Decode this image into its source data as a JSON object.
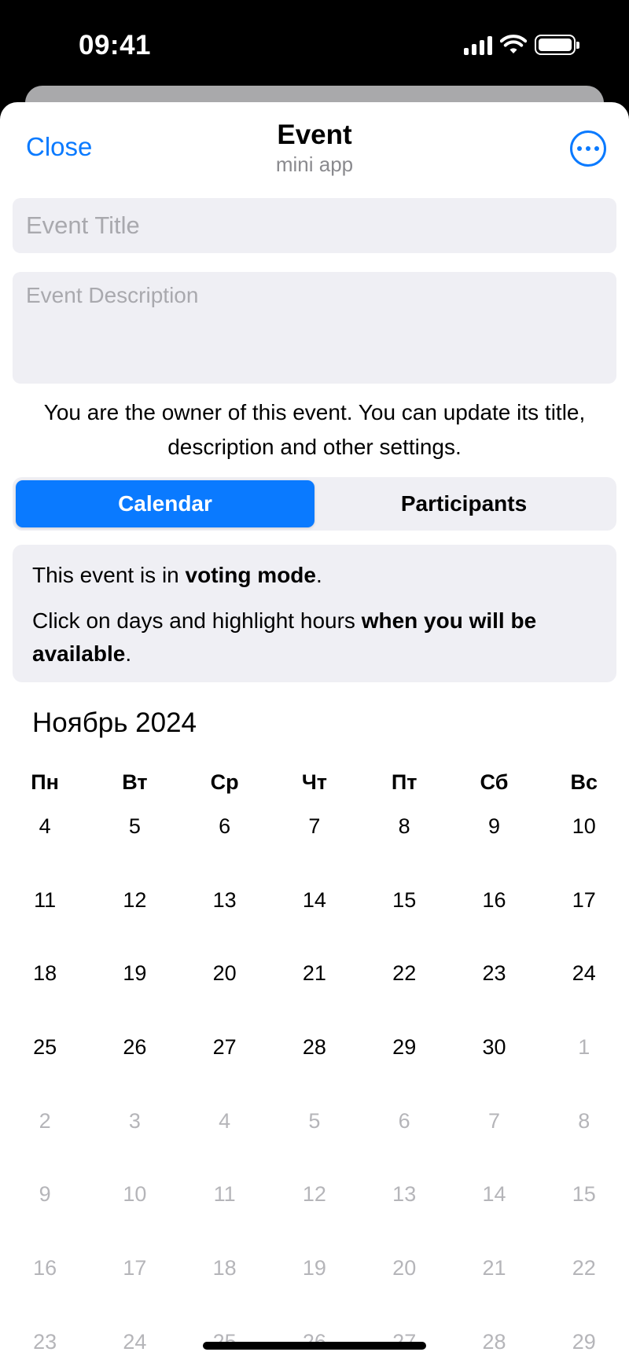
{
  "status": {
    "time": "09:41"
  },
  "nav": {
    "close_label": "Close",
    "title": "Event",
    "subtitle": "mini app"
  },
  "form": {
    "title_placeholder": "Event Title",
    "title_value": "",
    "description_placeholder": "Event Description",
    "description_value": ""
  },
  "owner_note": "You are the owner of this event. You can update its title, description and other settings.",
  "tabs": [
    {
      "label": "Calendar",
      "active": true
    },
    {
      "label": "Participants",
      "active": false
    }
  ],
  "info": {
    "line1_prefix": "This event is in ",
    "line1_bold": "voting mode",
    "line1_suffix": ".",
    "line2_prefix": "Click on days and highlight hours ",
    "line2_bold": "when you will be available",
    "line2_suffix": "."
  },
  "calendar": {
    "month_label": "Ноябрь 2024",
    "weekdays": [
      "Пн",
      "Вт",
      "Ср",
      "Чт",
      "Пт",
      "Сб",
      "Вс"
    ],
    "weeks": [
      [
        {
          "d": "4",
          "m": false
        },
        {
          "d": "5",
          "m": false
        },
        {
          "d": "6",
          "m": false
        },
        {
          "d": "7",
          "m": false
        },
        {
          "d": "8",
          "m": false
        },
        {
          "d": "9",
          "m": false
        },
        {
          "d": "10",
          "m": false
        }
      ],
      [
        {
          "d": "11",
          "m": false
        },
        {
          "d": "12",
          "m": false
        },
        {
          "d": "13",
          "m": false
        },
        {
          "d": "14",
          "m": false
        },
        {
          "d": "15",
          "m": false
        },
        {
          "d": "16",
          "m": false
        },
        {
          "d": "17",
          "m": false
        }
      ],
      [
        {
          "d": "18",
          "m": false
        },
        {
          "d": "19",
          "m": false
        },
        {
          "d": "20",
          "m": false
        },
        {
          "d": "21",
          "m": false
        },
        {
          "d": "22",
          "m": false
        },
        {
          "d": "23",
          "m": false
        },
        {
          "d": "24",
          "m": false
        }
      ],
      [
        {
          "d": "25",
          "m": false
        },
        {
          "d": "26",
          "m": false
        },
        {
          "d": "27",
          "m": false
        },
        {
          "d": "28",
          "m": false
        },
        {
          "d": "29",
          "m": false
        },
        {
          "d": "30",
          "m": false
        },
        {
          "d": "1",
          "m": true
        }
      ],
      [
        {
          "d": "2",
          "m": true
        },
        {
          "d": "3",
          "m": true
        },
        {
          "d": "4",
          "m": true
        },
        {
          "d": "5",
          "m": true
        },
        {
          "d": "6",
          "m": true
        },
        {
          "d": "7",
          "m": true
        },
        {
          "d": "8",
          "m": true
        }
      ],
      [
        {
          "d": "9",
          "m": true
        },
        {
          "d": "10",
          "m": true
        },
        {
          "d": "11",
          "m": true
        },
        {
          "d": "12",
          "m": true
        },
        {
          "d": "13",
          "m": true
        },
        {
          "d": "14",
          "m": true
        },
        {
          "d": "15",
          "m": true
        }
      ],
      [
        {
          "d": "16",
          "m": true
        },
        {
          "d": "17",
          "m": true
        },
        {
          "d": "18",
          "m": true
        },
        {
          "d": "19",
          "m": true
        },
        {
          "d": "20",
          "m": true
        },
        {
          "d": "21",
          "m": true
        },
        {
          "d": "22",
          "m": true
        }
      ],
      [
        {
          "d": "23",
          "m": true
        },
        {
          "d": "24",
          "m": true
        },
        {
          "d": "25",
          "m": true
        },
        {
          "d": "26",
          "m": true
        },
        {
          "d": "27",
          "m": true
        },
        {
          "d": "28",
          "m": true
        },
        {
          "d": "29",
          "m": true
        }
      ]
    ]
  },
  "colors": {
    "accent": "#0a7aff",
    "field_bg": "#efeff4",
    "muted_day": "#b5b5b9"
  }
}
